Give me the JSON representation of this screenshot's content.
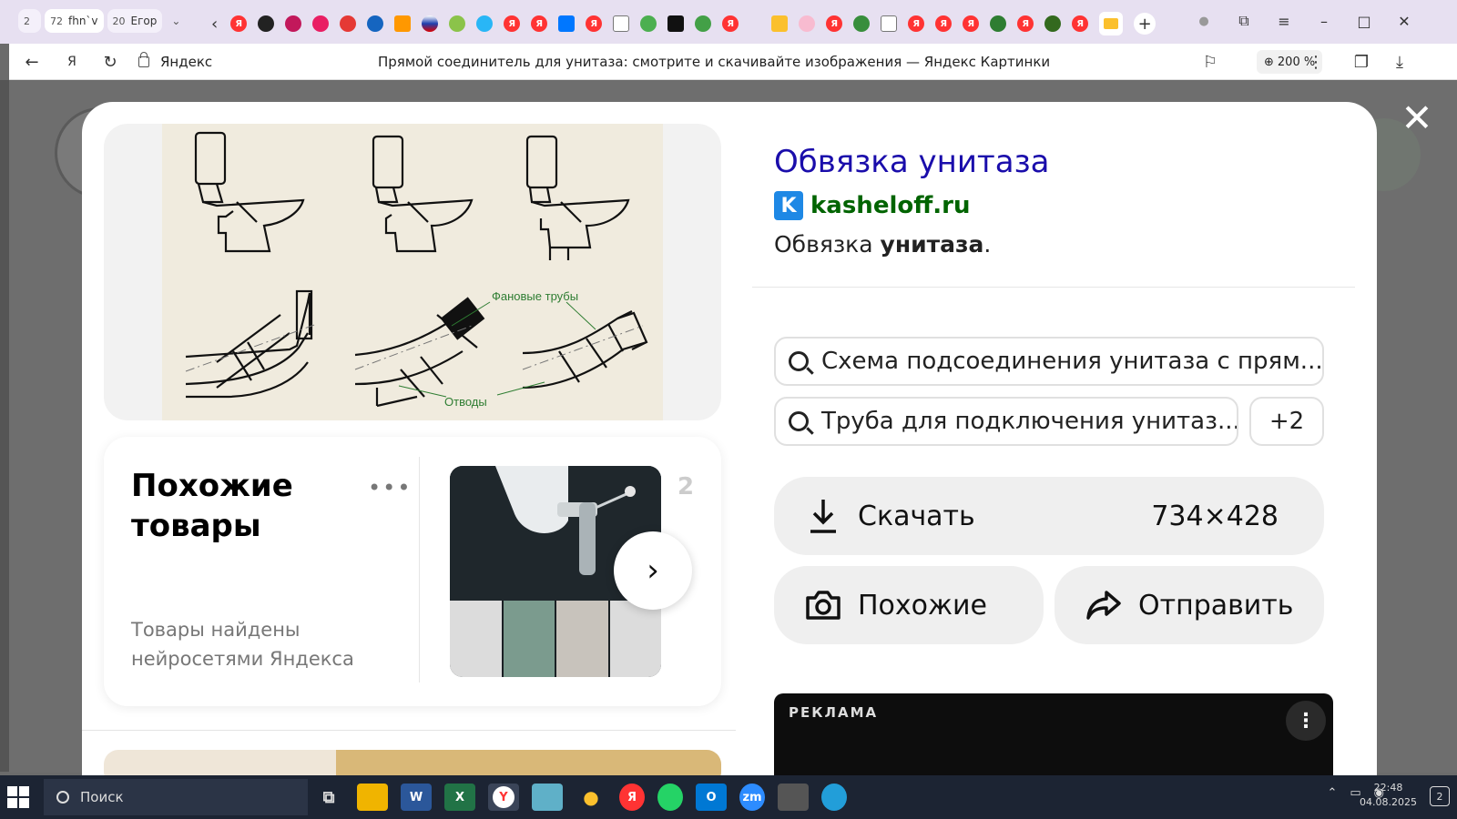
{
  "browser": {
    "tab_groups": [
      {
        "count": "2",
        "label": ""
      },
      {
        "count": "72",
        "label": "fhn`v"
      },
      {
        "count": "20",
        "label": "Егор"
      }
    ],
    "site_label": "Яндекс",
    "page_title": "Прямой соединитель для унитаза: смотрите и скачивайте изображения — Яндекс Картинки",
    "zoom": "200 %"
  },
  "modal": {
    "image_labels": {
      "pipes": "Фановые трубы",
      "bends": "Отводы"
    },
    "similar": {
      "title": "Похожие товары",
      "subtitle": "Товары найдены нейросетями Яндекса",
      "more": "•••",
      "peek": "2"
    },
    "info": {
      "title": "Обвязка унитаза",
      "domain": "kasheloff.ru",
      "domain_logo": "K",
      "desc_plain": "Обвязка ",
      "desc_bold": "унитаза",
      "desc_end": "."
    },
    "searches": [
      "Схема подсоединения унитаза с прям...",
      "Труба для подключения унитаз..."
    ],
    "more_searches": "+2",
    "actions": {
      "download": "Скачать",
      "size": "734×428",
      "similar": "Похожие",
      "share": "Отправить"
    },
    "ad": {
      "label": "РЕКЛАМА"
    }
  },
  "taskbar": {
    "search_placeholder": "Поиск",
    "time": "22:48",
    "date": "04.08.2025",
    "notifications": "2"
  },
  "colors": {
    "link_title": "#1a0dab",
    "domain_green": "#006400",
    "modal_bg": "#ffffff",
    "overlay": "#6b6b6b"
  }
}
